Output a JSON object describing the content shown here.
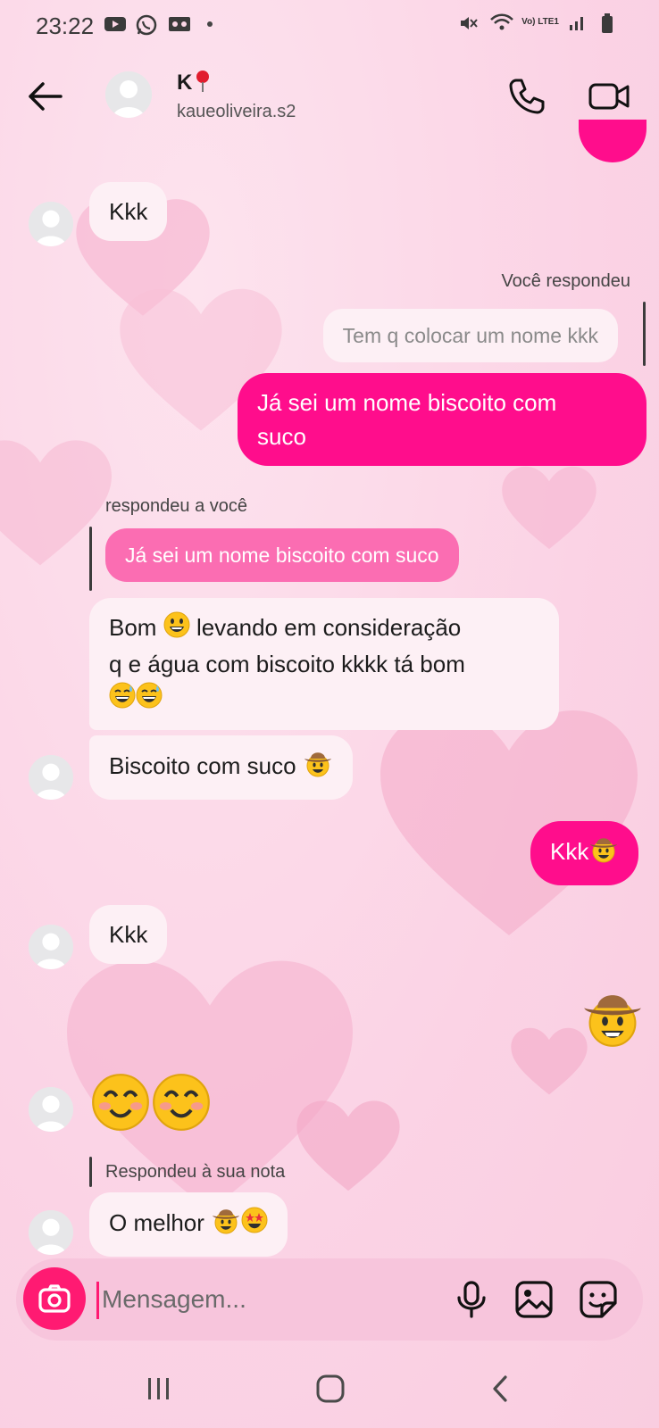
{
  "status_bar": {
    "time": "23:22",
    "network_label": "Vo) LTE1"
  },
  "header": {
    "name": "K",
    "username": "kaueoliveira.s2"
  },
  "messages": {
    "m1": "Kkk",
    "reply1_label": "Você respondeu",
    "reply1_quote": "Tem q colocar um nome kkk",
    "m2_line1": "Já sei um nome biscoito com",
    "m2_line2": "suco",
    "reply2_label": "respondeu a você",
    "reply2_quote": "Já sei um nome biscoito com suco",
    "m3_part1": "Bom",
    "m3_part2": "levando em consideração",
    "m3_line2": "q e água com biscoito kkkk tá bom",
    "m4": "Biscoito com suco",
    "m5": "Kkk",
    "m6": "Kkk",
    "reply3_label": "Respondeu à sua nota",
    "m7": "O melhor"
  },
  "composer": {
    "placeholder": "Mensagem..."
  },
  "colors": {
    "outgoing": "#ff0d8c",
    "incoming": "#fdf0f5",
    "quoted_incoming": "#fb6db2",
    "accent": "#ff1a72"
  },
  "icons": [
    "back-arrow-icon",
    "phone-icon",
    "video-icon",
    "camera-icon",
    "microphone-icon",
    "gallery-icon",
    "sticker-icon",
    "grinning-emoji",
    "sweat-smile-emoji",
    "cowboy-emoji",
    "smiling-blush-emoji",
    "star-struck-emoji"
  ]
}
